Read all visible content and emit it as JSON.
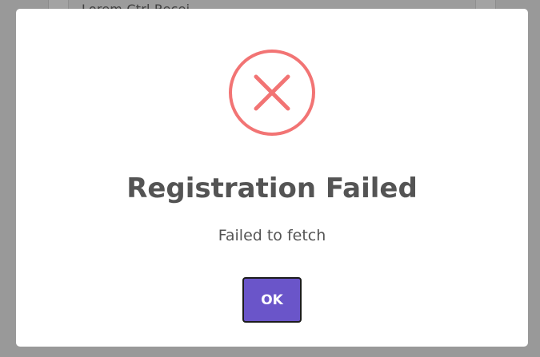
{
  "background": {
    "partial_text": "Lorem Ctrl Recei"
  },
  "modal": {
    "icon": "error-x-circle-icon",
    "icon_color": "#f27474",
    "title": "Registration Failed",
    "message": "Failed to fetch",
    "ok_label": "OK",
    "button_color": "#6a55c9"
  }
}
